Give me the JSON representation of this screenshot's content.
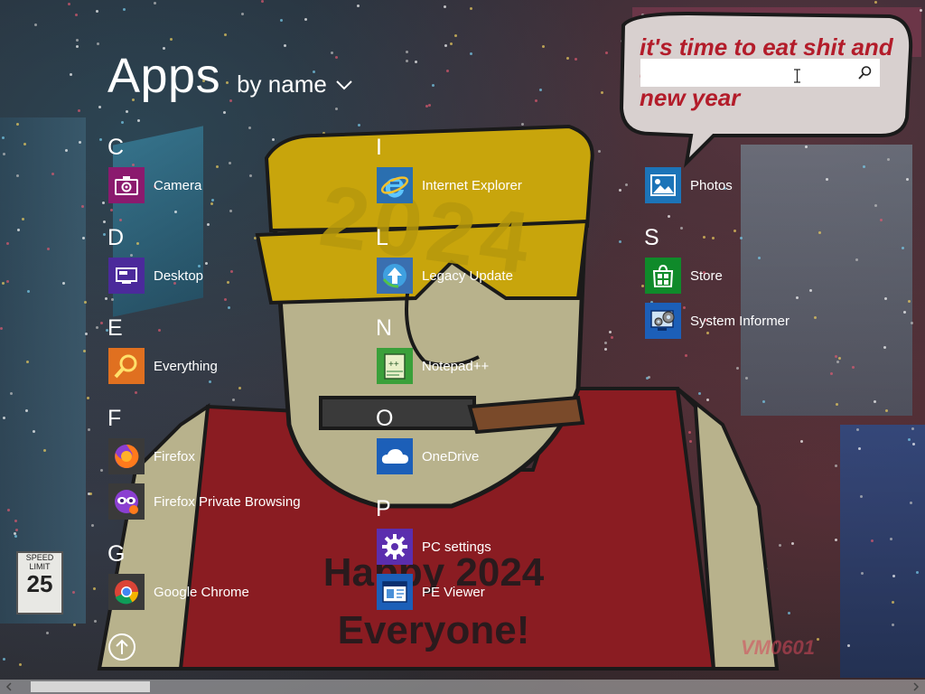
{
  "header": {
    "title": "Apps",
    "sort_label": "by name"
  },
  "search": {
    "value": "",
    "placeholder": ""
  },
  "columns": [
    {
      "groups": [
        {
          "letter": "C",
          "apps": [
            {
              "label": "Camera",
              "icon": "camera-icon",
              "color": "#8b1a6e"
            }
          ]
        },
        {
          "letter": "D",
          "apps": [
            {
              "label": "Desktop",
              "icon": "desktop-icon",
              "color": "#4b2a9b"
            }
          ]
        },
        {
          "letter": "E",
          "apps": [
            {
              "label": "Everything",
              "icon": "magnifier-icon",
              "color": "#e07020"
            }
          ]
        },
        {
          "letter": "F",
          "apps": [
            {
              "label": "Firefox",
              "icon": "firefox-icon",
              "color": "#3a3a3a"
            },
            {
              "label": "Firefox Private Browsing",
              "icon": "firefox-private-icon",
              "color": "#3a3a3a"
            }
          ]
        },
        {
          "letter": "G",
          "apps": [
            {
              "label": "Google Chrome",
              "icon": "chrome-icon",
              "color": "#3a3a3a"
            }
          ]
        }
      ]
    },
    {
      "groups": [
        {
          "letter": "I",
          "apps": [
            {
              "label": "Internet Explorer",
              "icon": "internet-explorer-icon",
              "color": "#2a6fb0"
            }
          ]
        },
        {
          "letter": "L",
          "apps": [
            {
              "label": "Legacy Update",
              "icon": "legacy-update-icon",
              "color": "#3a6fb0"
            }
          ]
        },
        {
          "letter": "N",
          "apps": [
            {
              "label": "Notepad++",
              "icon": "notepad-plus-icon",
              "color": "#3aa03a"
            }
          ]
        },
        {
          "letter": "O",
          "apps": [
            {
              "label": "OneDrive",
              "icon": "onedrive-icon",
              "color": "#1c5fb8"
            }
          ]
        },
        {
          "letter": "P",
          "apps": [
            {
              "label": "PC settings",
              "icon": "gear-icon",
              "color": "#5b2eae"
            },
            {
              "label": "PE Viewer",
              "icon": "pe-viewer-icon",
              "color": "#1c5fb8"
            }
          ]
        }
      ]
    },
    {
      "groups": [
        {
          "letter": "",
          "apps": [
            {
              "label": "Photos",
              "icon": "photos-icon",
              "color": "#1c74b8"
            }
          ]
        },
        {
          "letter": "S",
          "apps": [
            {
              "label": "Store",
              "icon": "store-icon",
              "color": "#0f8a2a"
            },
            {
              "label": "System Informer",
              "icon": "system-informer-icon",
              "color": "#1c5fb8"
            }
          ]
        }
      ]
    }
  ],
  "wallpaper": {
    "bubble_text": "it's time to eat shit and die and celebrate the new year",
    "hat_text": "2024",
    "sign_line1": "Happy 2024",
    "sign_line2": "Everyone!",
    "watermark": "VM0601",
    "street_sign_top": "SPEED LIMIT",
    "street_sign_number": "25"
  },
  "colors": {
    "background": "#2a2326",
    "text": "#ffffff",
    "bubble_text": "#b31c2a",
    "hat": "#c8a50c",
    "shirt": "#8a1c22",
    "skin": "#b8b28c"
  }
}
